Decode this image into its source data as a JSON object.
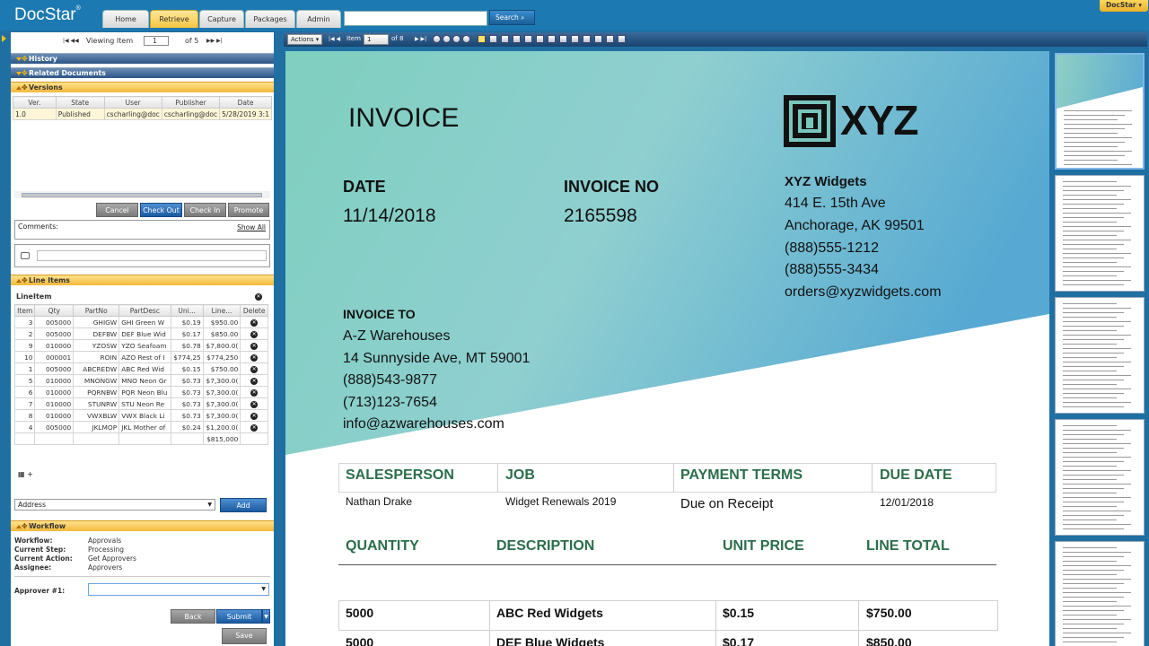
{
  "app": {
    "logo": "DocStar",
    "logo_mark": "®",
    "user_menu": "DocStar ▾"
  },
  "nav": {
    "tabs": [
      "Home",
      "Retrieve",
      "Capture",
      "Packages",
      "Admin"
    ],
    "active": "Retrieve",
    "search_button": "Search",
    "search_value": ""
  },
  "pager": {
    "label": "Viewing Item",
    "current": "1",
    "total": "of 5"
  },
  "sections": {
    "history": "History",
    "related": "Related Documents",
    "versions": "Versions",
    "line_items": "Line Items",
    "workflow": "Workflow"
  },
  "versions": {
    "headers": [
      "Ver.",
      "State",
      "User",
      "Publisher",
      "Date"
    ],
    "rows": [
      [
        "1.0",
        "Published",
        "cscharling@doc",
        "cscharling@doc",
        "5/28/2019 3:1"
      ]
    ]
  },
  "version_buttons": {
    "cancel": "Cancel",
    "checkout": "Check Out",
    "checkin": "Check In",
    "promote": "Promote"
  },
  "comments": {
    "label": "Comments:",
    "show_all": "Show All"
  },
  "lineitems": {
    "title": "LineItem",
    "headers": [
      "Item",
      "Qty",
      "PartNo",
      "PartDesc",
      "Uni...",
      "Line...",
      "Delete"
    ],
    "rows": [
      [
        "3",
        "005000",
        "GHIGW",
        "GHI Green W",
        "$0.19",
        "$950.00"
      ],
      [
        "2",
        "005000",
        "DEFBW",
        "DEF Blue Wid",
        "$0.17",
        "$850.00"
      ],
      [
        "9",
        "010000",
        "YZOSW",
        "YZO Seafoam",
        "$0.78",
        "$7,800.0("
      ],
      [
        "10",
        "000001",
        "ROIN",
        "AZO Rest of I",
        "$774,25",
        "$774,250"
      ],
      [
        "1",
        "005000",
        "ABCREDW",
        "ABC Red Wid",
        "$0.15",
        "$750.00"
      ],
      [
        "5",
        "010000",
        "MNONGW",
        "MNO Neon Gr",
        "$0.73",
        "$7,300.0("
      ],
      [
        "6",
        "010000",
        "PQRNBW",
        "PQR Neon Blu",
        "$0.73",
        "$7,300.0("
      ],
      [
        "7",
        "010000",
        "STUNRW",
        "STU Neon Re",
        "$0.73",
        "$7,300.0("
      ],
      [
        "8",
        "010000",
        "VWXBLW",
        "VWX Black Li",
        "$0.73",
        "$7,300.0("
      ],
      [
        "4",
        "005000",
        "JKLMOP",
        "JKL Mother of",
        "$0.24",
        "$1,200.0("
      ]
    ],
    "total": "$815,000",
    "footer_add": "+"
  },
  "address": {
    "select": "Address",
    "add": "Add"
  },
  "workflow": {
    "rows": [
      [
        "Workflow:",
        "Approvals"
      ],
      [
        "Current Step:",
        "Processing"
      ],
      [
        "Current Action:",
        "Get Approvers"
      ],
      [
        "Assignee:",
        "Approvers"
      ]
    ],
    "approver_label": "Approver #1:",
    "back": "Back",
    "submit": "Submit",
    "save": "Save"
  },
  "viewer": {
    "actions": "Actions ▾",
    "item_label": "Item",
    "item_value": "1",
    "item_of": "of 8"
  },
  "invoice": {
    "title": "INVOICE",
    "logo_text": "XYZ",
    "date_label": "DATE",
    "date": "11/14/2018",
    "invno_label": "INVOICE NO",
    "invno": "2165598",
    "company": "XYZ Widgets",
    "company_lines": [
      "414 E. 15th Ave",
      "Anchorage, AK 99501",
      "(888)555-1212",
      "(888)555-3434",
      "orders@xyzwidgets.com"
    ],
    "to_label": "INVOICE TO",
    "to_lines": [
      "A-Z Warehouses",
      "14 Sunnyside Ave, MT 59001",
      "(888)543-9877",
      "(713)123-7654",
      "info@azwarehouses.com"
    ],
    "info_headers": [
      "SALESPERSON",
      "JOB",
      "PAYMENT TERMS",
      "DUE DATE"
    ],
    "info_values": [
      "Nathan Drake",
      "Widget Renewals 2019",
      "Due on Receipt",
      "12/01/2018"
    ],
    "item_headers": [
      "QUANTITY",
      "DESCRIPTION",
      "UNIT PRICE",
      "LINE TOTAL"
    ],
    "items": [
      [
        "5000",
        "ABC Red Widgets",
        "$0.15",
        "$750.00"
      ],
      [
        "5000",
        "DEF Blue Widgets",
        "$0.17",
        "$850.00"
      ]
    ]
  },
  "colors": {
    "accent": "#f4b93a",
    "brand": "#1d79b1",
    "doc_green": "#2b6e4a",
    "teal": "#6cc3b9"
  }
}
